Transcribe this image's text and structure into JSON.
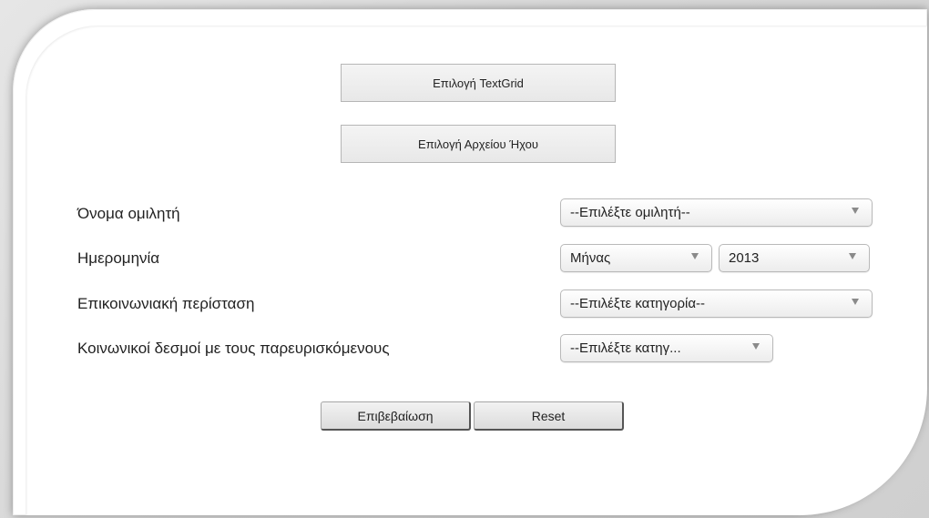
{
  "files": {
    "textgrid_label": "Επιλογή TextGrid",
    "audio_label": "Επιλογή Αρχείου Ήχου"
  },
  "form": {
    "speaker_label": "Όνομα ομιλητή",
    "speaker_select": "--Επιλέξτε ομιλητή--",
    "date_label": "Ημερομηνία",
    "month_select": "Μήνας",
    "year_select": "2013",
    "context_label": "Επικοινωνιακή περίσταση",
    "context_select": "--Επιλέξτε κατηγορία--",
    "ties_label": "Κοινωνικοί δεσμοί με τους παρευρισκόμενους",
    "ties_select": "--Επιλέξτε κατηγ..."
  },
  "actions": {
    "confirm_label": "Επιβεβαίωση",
    "reset_label": "Reset"
  }
}
